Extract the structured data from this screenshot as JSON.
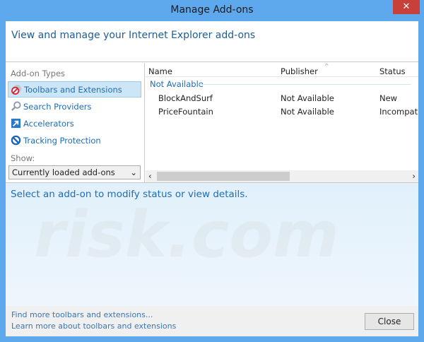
{
  "window": {
    "title": "Manage Add-ons",
    "close_glyph": "✕"
  },
  "header": {
    "title": "View and manage your Internet Explorer add-ons"
  },
  "left": {
    "types_label": "Add-on Types",
    "types": [
      {
        "label": "Toolbars and Extensions",
        "icon": "toolbars-extensions-icon",
        "selected": true
      },
      {
        "label": "Search Providers",
        "icon": "search-icon"
      },
      {
        "label": "Accelerators",
        "icon": "accelerator-icon"
      },
      {
        "label": "Tracking Protection",
        "icon": "tracking-protection-icon"
      }
    ],
    "show_label": "Show:",
    "show_value": "Currently loaded add-ons"
  },
  "list": {
    "columns": [
      "Name",
      "Publisher",
      "Status"
    ],
    "group": "Not Available",
    "rows": [
      {
        "name": "BlockAndSurf",
        "publisher": "Not Available",
        "status": "New"
      },
      {
        "name": "PriceFountain",
        "publisher": "Not Available",
        "status": "Incompatib"
      }
    ]
  },
  "details": {
    "text": "Select an add-on to modify status or view details."
  },
  "footer": {
    "link1": "Find more toolbars and extensions...",
    "link2": "Learn more about toolbars and extensions",
    "close": "Close"
  },
  "watermark": "risk.com"
}
